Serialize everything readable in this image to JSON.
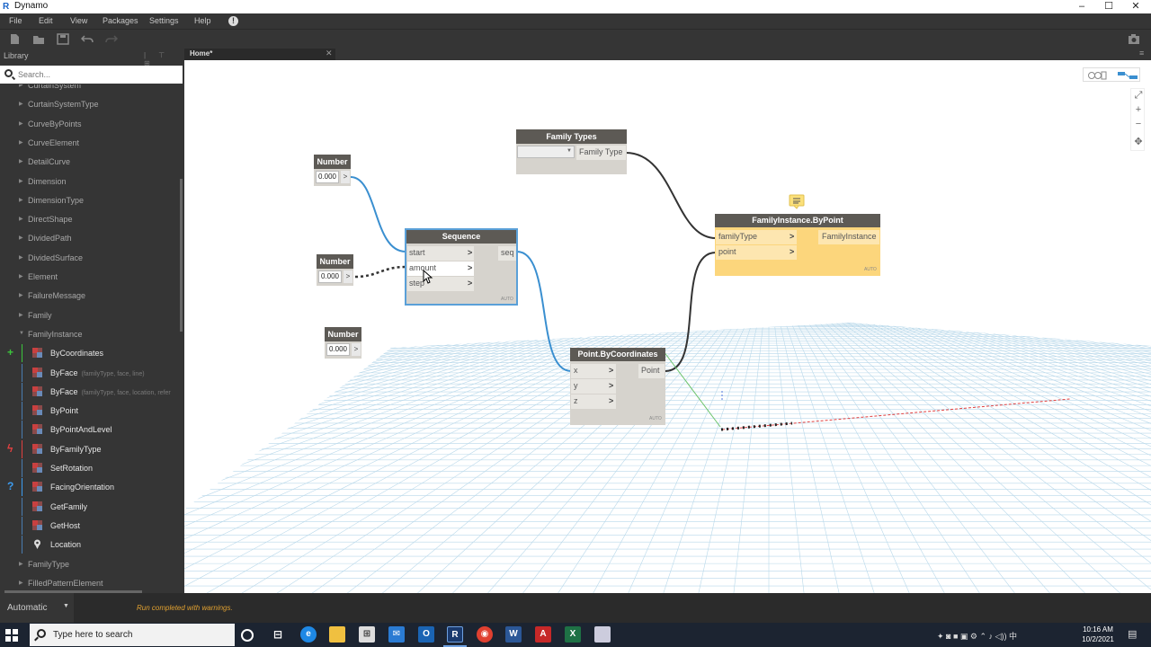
{
  "window": {
    "app_icon": "R",
    "title": "Dynamo",
    "controls": [
      "–",
      "☐",
      "✕"
    ]
  },
  "menu": {
    "items": [
      "File",
      "Edit",
      "View",
      "Packages",
      "Settings",
      "Help"
    ],
    "info_icon": "!"
  },
  "toolbar": {
    "buttons": [
      "new-file-icon",
      "open-folder-icon",
      "save-icon",
      "undo-icon",
      "redo-icon"
    ],
    "camera_icon": "camera-icon"
  },
  "library": {
    "title": "Library",
    "header_icons": "|  ⊤  ⊞",
    "search_placeholder": "Search...",
    "partial_top_item": "CurtainSystem",
    "categories_top": [
      "CurtainSystemType",
      "CurveByPoints",
      "CurveElement",
      "DetailCurve",
      "Dimension",
      "DimensionType",
      "DirectShape",
      "DividedPath",
      "DividedSurface",
      "Element",
      "FailureMessage",
      "Family"
    ],
    "expanded_category": "FamilyInstance",
    "members": [
      {
        "label": "ByCoordinates",
        "params": "",
        "icon": "create-icon",
        "side": "+",
        "side_color": "#3cc43c"
      },
      {
        "label": "ByFace",
        "params": "(familyType, face, line)",
        "icon": "create-icon",
        "side": "",
        "side_color": ""
      },
      {
        "label": "ByFace",
        "params": "(familyType, face, location, refer",
        "icon": "create-icon",
        "side": "",
        "side_color": ""
      },
      {
        "label": "ByPoint",
        "params": "",
        "icon": "create-icon",
        "side": "",
        "side_color": ""
      },
      {
        "label": "ByPointAndLevel",
        "params": "",
        "icon": "create-icon",
        "side": "",
        "side_color": ""
      },
      {
        "label": "ByFamilyType",
        "params": "",
        "icon": "create-icon",
        "side": "ϟ",
        "side_color": "#e04040"
      },
      {
        "label": "SetRotation",
        "params": "",
        "icon": "action-icon",
        "side": "",
        "side_color": ""
      },
      {
        "label": "FacingOrientation",
        "params": "",
        "icon": "query-icon",
        "side": "?",
        "side_color": "#3c9cf0"
      },
      {
        "label": "GetFamily",
        "params": "",
        "icon": "query-icon",
        "side": "",
        "side_color": ""
      },
      {
        "label": "GetHost",
        "params": "",
        "icon": "query-icon",
        "side": "",
        "side_color": ""
      },
      {
        "label": "Location",
        "params": "",
        "icon": "location-pin-icon",
        "side": "",
        "side_color": ""
      }
    ],
    "categories_bottom": [
      "FamilyType",
      "FilledPatternElement"
    ]
  },
  "tab": {
    "label": "Home*",
    "close": "✕",
    "menu_icon": "≡"
  },
  "canvas": {
    "zoom_controls": [
      "⤢",
      "+",
      "−",
      "✥"
    ],
    "number_nodes": [
      {
        "title": "Number",
        "value": "0.000",
        "out": ">"
      },
      {
        "title": "Number",
        "value": "0.000",
        "out": ">"
      },
      {
        "title": "Number",
        "value": "0.000",
        "out": ">"
      }
    ],
    "sequence": {
      "title": "Sequence",
      "inputs": [
        "start",
        "amount",
        "step"
      ],
      "output": "seq",
      "lacing": "AUTO"
    },
    "family_types": {
      "title": "Family Types",
      "dropdown_value": "",
      "output": "Family Type"
    },
    "point_by_coords": {
      "title": "Point.ByCoordinates",
      "inputs": [
        "x",
        "y",
        "z"
      ],
      "output": "Point",
      "lacing": "AUTO"
    },
    "family_instance": {
      "title": "FamilyInstance.ByPoint",
      "inputs": [
        "familyType",
        "point"
      ],
      "output": "FamilyInstance",
      "lacing": "AUTO",
      "has_warning_bubble": true
    },
    "port_arrow": ">"
  },
  "status": {
    "run_mode": "Automatic",
    "message": "Run completed with warnings.",
    "message_color": "#e0a030"
  },
  "taskbar": {
    "search_placeholder": "Type here to search",
    "time": "10:16 AM",
    "date": "10/2/2021"
  }
}
